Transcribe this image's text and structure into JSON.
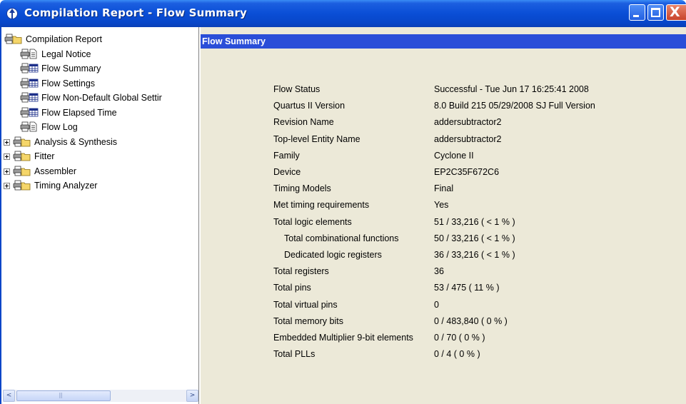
{
  "window": {
    "title": "Compilation Report - Flow Summary",
    "close_glyph": "X"
  },
  "tree": {
    "items": [
      {
        "label": "Compilation Report",
        "icon": "folder-open-icon"
      },
      {
        "label": "Legal Notice",
        "icon": "document-icon"
      },
      {
        "label": "Flow Summary",
        "icon": "table-icon"
      },
      {
        "label": "Flow Settings",
        "icon": "table-icon"
      },
      {
        "label": "Flow Non-Default Global Settir",
        "icon": "table-icon"
      },
      {
        "label": "Flow Elapsed Time",
        "icon": "table-icon"
      },
      {
        "label": "Flow Log",
        "icon": "document-icon"
      },
      {
        "label": "Analysis & Synthesis",
        "icon": "folder-icon"
      },
      {
        "label": "Fitter",
        "icon": "folder-icon"
      },
      {
        "label": "Assembler",
        "icon": "folder-icon"
      },
      {
        "label": "Timing Analyzer",
        "icon": "folder-icon"
      }
    ]
  },
  "scrollbar": {
    "left_arrow": "<",
    "right_arrow": ">"
  },
  "panel": {
    "header": "Flow Summary"
  },
  "summary": [
    {
      "key": "Flow Status",
      "value": "Successful - Tue Jun 17 16:25:41 2008"
    },
    {
      "key": "Quartus II Version",
      "value": "8.0 Build 215 05/29/2008 SJ Full Version"
    },
    {
      "key": "Revision Name",
      "value": "addersubtractor2"
    },
    {
      "key": "Top-level Entity Name",
      "value": "addersubtractor2"
    },
    {
      "key": "Family",
      "value": "Cyclone II"
    },
    {
      "key": "Device",
      "value": "EP2C35F672C6"
    },
    {
      "key": "Timing Models",
      "value": "Final"
    },
    {
      "key": "Met timing requirements",
      "value": "Yes"
    },
    {
      "key": "Total logic elements",
      "value": "51 / 33,216 ( < 1 % )"
    },
    {
      "key": "Total combinational functions",
      "value": "50 / 33,216 ( < 1 % )"
    },
    {
      "key": "Dedicated logic registers",
      "value": "36 / 33,216 ( < 1 % )"
    },
    {
      "key": "Total registers",
      "value": "36"
    },
    {
      "key": "Total pins",
      "value": "53 / 475 ( 11 % )"
    },
    {
      "key": "Total virtual pins",
      "value": "0"
    },
    {
      "key": "Total memory bits",
      "value": "0 / 483,840 ( 0 % )"
    },
    {
      "key": "Embedded Multiplier 9-bit elements",
      "value": "0 / 70 ( 0 % )"
    },
    {
      "key": "Total PLLs",
      "value": "0 / 4 ( 0 % )"
    }
  ]
}
